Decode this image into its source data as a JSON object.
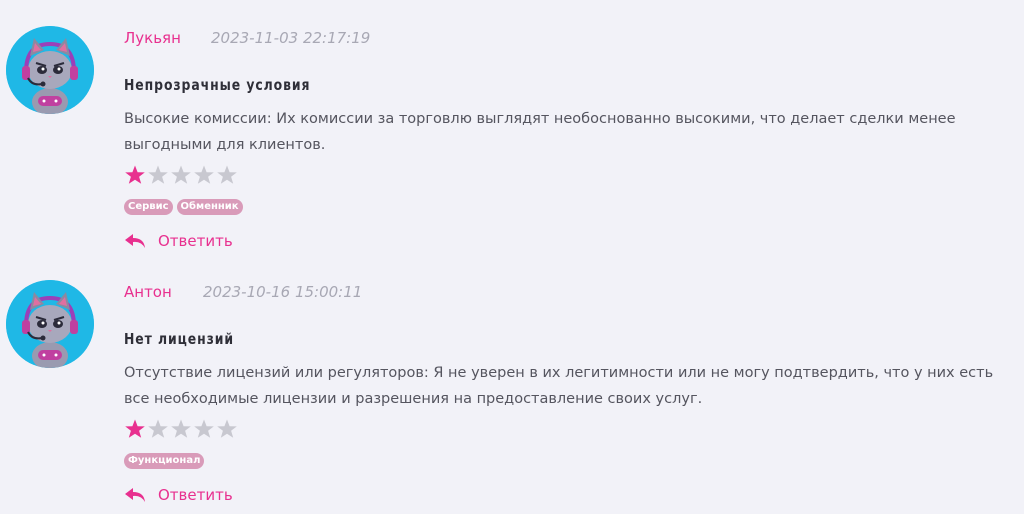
{
  "colors": {
    "accent": "#e8308f",
    "avatar_bg": "#1fb8e6",
    "tag_bg": "#d99bb9",
    "star_empty": "#c8c8d0",
    "background": "#f2f2f8"
  },
  "reviews": [
    {
      "author": "Лукьян",
      "date": "2023-11-03 22:17:19",
      "title": "Непрозрачные условия",
      "body": "Высокие комиссии: Их комиссии за торговлю выглядят необоснованно высокими, что делает сделки менее выгодными для клиентов.",
      "rating": 1,
      "rating_max": 5,
      "tags": [
        "Сервис",
        "Обменник"
      ],
      "reply_label": "Ответить",
      "avatar_icon": "cat-gamer-avatar-icon"
    },
    {
      "author": "Антон",
      "date": "2023-10-16 15:00:11",
      "title": "Нет лицензий",
      "body": "Отсутствие лицензий или регуляторов: Я не уверен в их легитимности или не могу подтвердить, что у них есть все необходимые лицензии и разрешения на предоставление своих услуг.",
      "rating": 1,
      "rating_max": 5,
      "tags": [
        "Функционал"
      ],
      "reply_label": "Ответить",
      "avatar_icon": "cat-gamer-avatar-icon"
    }
  ]
}
